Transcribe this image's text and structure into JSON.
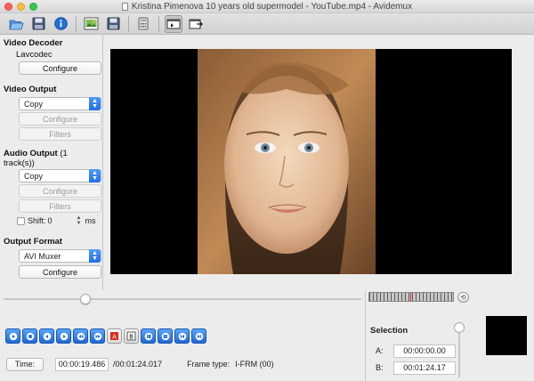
{
  "window": {
    "title": "Kristina Pimenova 10 years old supermodel - YouTube.mp4 - Avidemux"
  },
  "toolbar": {
    "icons": [
      "open-folder-icon",
      "save-icon",
      "info-icon",
      "open-image-icon",
      "save-image-icon",
      "calculator-icon",
      "input-preview-icon",
      "output-preview-icon"
    ]
  },
  "left": {
    "video_decoder": {
      "title": "Video Decoder",
      "codec": "Lavcodec",
      "configure": "Configure"
    },
    "video_output": {
      "title": "Video Output",
      "selected": "Copy",
      "configure": "Configure",
      "filters": "Filters"
    },
    "audio_output": {
      "title": "Audio Output",
      "tracks": "(1 track(s))",
      "selected": "Copy",
      "configure": "Configure",
      "filters": "Filters",
      "shift_label": "Shift:",
      "shift_value": "0",
      "shift_unit": "ms"
    },
    "output_format": {
      "title": "Output Format",
      "selected": "AVI Muxer",
      "configure": "Configure"
    }
  },
  "timeline": {
    "position_fraction": 0.23
  },
  "time": {
    "button": "Time:",
    "current": "00:00:19.486",
    "total": "/00:01:24.017",
    "frame_type_label": "Frame type:",
    "frame_type_value": "I-FRM (00)"
  },
  "selection": {
    "title": "Selection",
    "a_label": "A:",
    "a_value": "00:00:00.00",
    "b_label": "B:",
    "b_value": "00:01:24.17"
  },
  "colors": {
    "accent": "#2a7ae8",
    "video_bg": "#000000"
  }
}
